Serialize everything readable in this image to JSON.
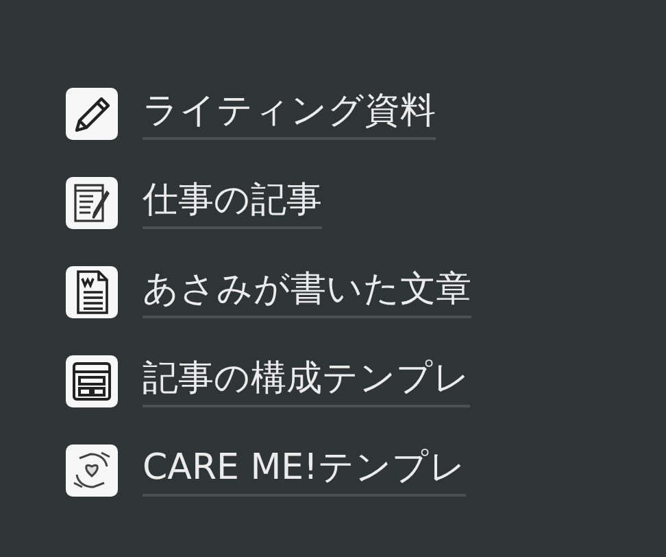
{
  "links": [
    {
      "kind": "pencil",
      "label": "ライティング資料"
    },
    {
      "kind": "edit",
      "label": "仕事の記事"
    },
    {
      "kind": "document",
      "label": "あさみが書いた文章"
    },
    {
      "kind": "layout",
      "label": "記事の構成テンプレ"
    },
    {
      "kind": "care",
      "label": "CARE ME!テンプレ"
    }
  ]
}
